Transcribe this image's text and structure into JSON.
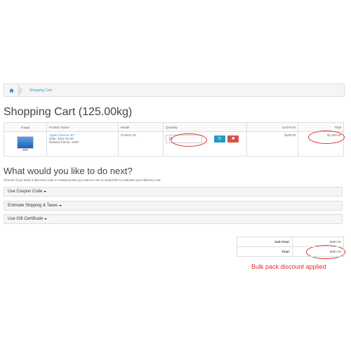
{
  "breadcrumb": {
    "home_icon": "home-icon",
    "current": "Shopping Cart"
  },
  "page": {
    "title": "Shopping Cart  (125.00kg)"
  },
  "cart_table": {
    "headers": {
      "image": "Image",
      "product_name": "Product Name",
      "model": "Model",
      "quantity": "Quantity",
      "unit_price": "Unit Price",
      "total": "Total"
    },
    "rows": [
      {
        "image_icon": "monitor-icon",
        "product_name": "Apple Cinema 30\"",
        "date": "Date: 2011-02-20",
        "reward_points": "Reward Points: 1000",
        "model": "Product 15",
        "quantity": "10",
        "refresh_icon": "refresh-icon",
        "remove_icon": "remove-icon",
        "unit_price": "$100.00",
        "total": "$1,000.00"
      }
    ]
  },
  "next_section": {
    "title": "What would you like to do next?",
    "subtitle": "Choose if you have a discount code or reward points you want to use or would like to estimate your delivery cost.",
    "panels": [
      {
        "label": "Use Coupon Code"
      },
      {
        "label": "Estimate Shipping & Taxes"
      },
      {
        "label": "Use Gift Certificate"
      }
    ]
  },
  "totals": {
    "subtotal_label": "Sub-Total:",
    "subtotal_value": "$880.00",
    "total_label": "Total:",
    "total_value": "$880.00"
  },
  "annotation": {
    "note": "Bulk pack discount applied",
    "color": "#e0312b"
  },
  "colors": {
    "link": "#23a1d1",
    "refresh_button": "#229ac8",
    "remove_button": "#da4f49",
    "highlight_oval": "#d9302c"
  }
}
